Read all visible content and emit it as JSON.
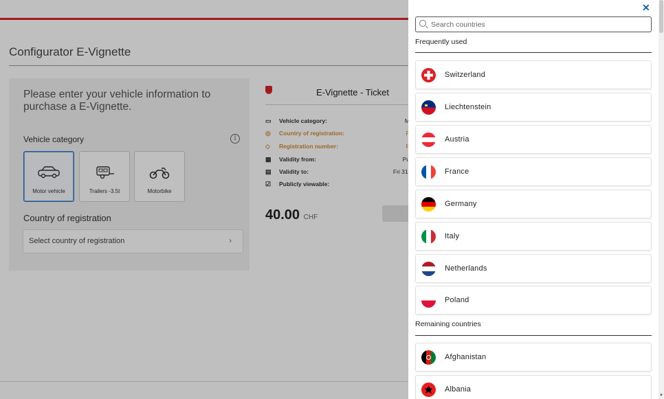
{
  "page": {
    "title": "Configurator E-Vignette",
    "intro": "Please enter your vehicle information to purchase a E-Vignette.",
    "vehicle_category_label": "Vehicle category",
    "vehicles": [
      {
        "label": "Motor vehicle",
        "icon": "car-icon",
        "selected": true
      },
      {
        "label": "Trailers -3.5t",
        "icon": "trailer-icon",
        "selected": false
      },
      {
        "label": "Motorbike",
        "icon": "motorbike-icon",
        "selected": false
      }
    ],
    "registration_label": "Country of registration",
    "registration_select": "Select country of registration"
  },
  "ticket": {
    "title": "E-Vignette - Ticket",
    "rows": [
      {
        "label": "Vehicle category:",
        "value": "M",
        "orange": false,
        "icon": "vehicle-icon"
      },
      {
        "label": "Country of registration:",
        "value": "P",
        "orange": true,
        "icon": "location-icon"
      },
      {
        "label": "Registration number:",
        "value": "P",
        "orange": true,
        "icon": "tag-icon"
      },
      {
        "label": "Validity from:",
        "value": "Pu",
        "orange": false,
        "icon": "calendar-icon"
      },
      {
        "label": "Validity to:",
        "value": "Fri 31.",
        "orange": false,
        "icon": "calendar-end-icon"
      },
      {
        "label": "Publicly viewable:",
        "value": "",
        "orange": false,
        "icon": "checkbox-icon"
      }
    ],
    "price": "40.00",
    "currency": "CHF"
  },
  "drawer": {
    "search_placeholder": "Search countries",
    "frequently_used_label": "Frequently used",
    "remaining_label": "Remaining countries",
    "frequent": [
      {
        "name": "Switzerland",
        "flag": "switzerland-flag-icon"
      },
      {
        "name": "Liechtenstein",
        "flag": "liechtenstein-flag-icon"
      },
      {
        "name": "Austria",
        "flag": "austria-flag-icon"
      },
      {
        "name": "France",
        "flag": "france-flag-icon"
      },
      {
        "name": "Germany",
        "flag": "germany-flag-icon"
      },
      {
        "name": "Italy",
        "flag": "italy-flag-icon"
      },
      {
        "name": "Netherlands",
        "flag": "netherlands-flag-icon"
      },
      {
        "name": "Poland",
        "flag": "poland-flag-icon"
      }
    ],
    "remaining": [
      {
        "name": "Afghanistan",
        "flag": "afghanistan-flag-icon"
      },
      {
        "name": "Albania",
        "flag": "albania-flag-icon"
      }
    ]
  },
  "colors": {
    "accent_red": "#d8232a",
    "link_blue": "#1a5fa8",
    "orange": "#d08a3a"
  }
}
